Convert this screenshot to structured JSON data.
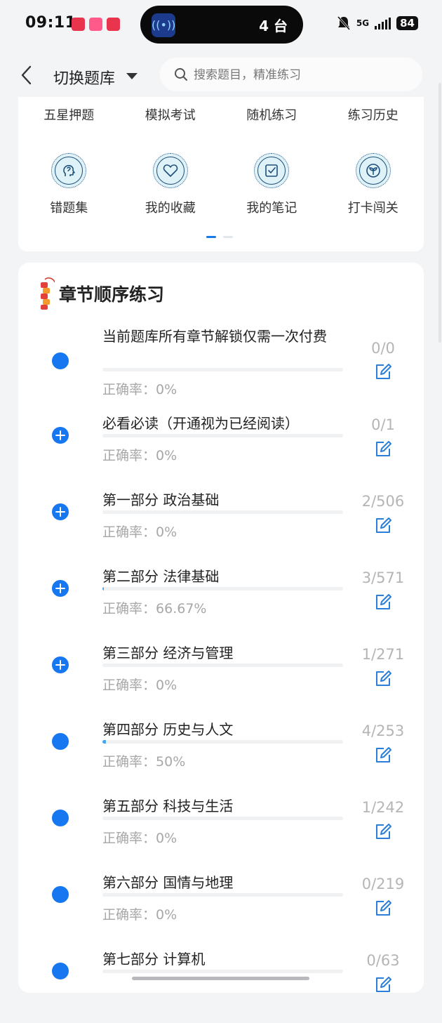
{
  "status_bar": {
    "time": "09:11",
    "island_count": "4 台",
    "network": "5G",
    "battery": "84"
  },
  "header": {
    "title": "切换题库",
    "search_placeholder": "搜索题目，精准练习"
  },
  "menu": {
    "row1": [
      "五星押题",
      "模拟考试",
      "随机练习",
      "练习历史"
    ],
    "row2": [
      {
        "label": "错题集",
        "icon": "head-icon"
      },
      {
        "label": "我的收藏",
        "icon": "heart-icon"
      },
      {
        "label": "我的笔记",
        "icon": "note-icon"
      },
      {
        "label": "打卡闯关",
        "icon": "sprout-icon"
      }
    ],
    "page_count": 2,
    "active_page": 1
  },
  "chapters": {
    "title": "章节顺序练习",
    "accuracy_label": "正确率：",
    "items": [
      {
        "name": "当前题库所有章节解锁仅需一次付费",
        "accuracy": "0%",
        "count": "0/0",
        "progress_pct": 0,
        "expandable": false
      },
      {
        "name": "必看必读（开通视为已经阅读）",
        "accuracy": "0%",
        "count": "0/1",
        "progress_pct": 0,
        "expandable": true
      },
      {
        "name": "第一部分 政治基础",
        "accuracy": "0%",
        "count": "2/506",
        "progress_pct": 0,
        "expandable": true
      },
      {
        "name": "第二部分 法律基础",
        "accuracy": "66.67%",
        "count": "3/571",
        "progress_pct": 0.5,
        "expandable": true
      },
      {
        "name": "第三部分 经济与管理",
        "accuracy": "0%",
        "count": "1/271",
        "progress_pct": 0,
        "expandable": true
      },
      {
        "name": "第四部分 历史与人文",
        "accuracy": "50%",
        "count": "4/253",
        "progress_pct": 1.6,
        "expandable": false
      },
      {
        "name": "第五部分 科技与生活",
        "accuracy": "0%",
        "count": "1/242",
        "progress_pct": 0,
        "expandable": false
      },
      {
        "name": "第六部分 国情与地理",
        "accuracy": "0%",
        "count": "0/219",
        "progress_pct": 0,
        "expandable": false
      },
      {
        "name": "第七部分 计算机",
        "accuracy": "",
        "count": "0/63",
        "progress_pct": 0,
        "expandable": false
      }
    ]
  },
  "colors": {
    "accent": "#1677f0",
    "progress": "#48a6f0",
    "muted": "#a7a7a7"
  }
}
